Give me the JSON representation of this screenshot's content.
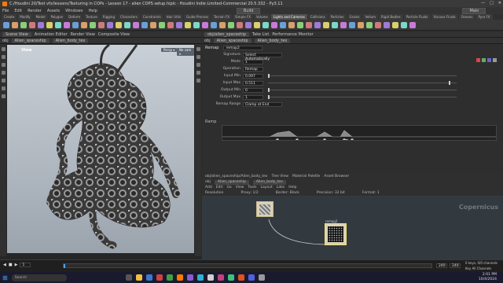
{
  "title": "C:/Houdini 20/Test vfx/lessons/Texturing in COPs - Lesson 17 - alien COPS setup.hiplc - Houdini Indie Limited-Commercial 20.5.332 - Py3.11",
  "window_controls": [
    "—",
    "□",
    "✕"
  ],
  "menu": [
    "File",
    "Edit",
    "Render",
    "Assets",
    "Windows",
    "Help"
  ],
  "build_label": "Build",
  "main_label": "Main",
  "shelf_tabs": [
    "Create",
    "Modify",
    "Model",
    "Polygon",
    "Deform",
    "Texture",
    "Rigging",
    "Characters",
    "Constraints",
    "Hair Utils",
    "Guide Process",
    "Terrain FX",
    "Simple FX",
    "Volume",
    "Lights and Cameras",
    "Collisions",
    "Particles",
    "Grains",
    "Vellum",
    "Rigid Bodies",
    "Particle Fluids",
    "Viscous Fluids",
    "Oceans",
    "Pyro FX"
  ],
  "shelf_active_index": 14,
  "left_panel": {
    "tabs": [
      "Scene View",
      "Animation Editor",
      "Render View",
      "Composite View",
      "Motion FX View",
      "Geometry Spreadsheet"
    ],
    "path": [
      "obj",
      "Alien_spaceship",
      "Alien_body_tex"
    ],
    "viewport_label": "View",
    "persp": "Persp ▾",
    "cam": "No cam ▾"
  },
  "right_panel": {
    "tabs": [
      "obj/alien_spaceship",
      "Take List",
      "Performance Monitor"
    ],
    "path": [
      "obj",
      "Alien_spaceship",
      "Alien_body_tex"
    ],
    "node_type": "Remap",
    "node_name": "remap2",
    "params": [
      {
        "label": "Signature",
        "value": "Select Automatically"
      },
      {
        "label": "Mode",
        "value": "1"
      },
      {
        "label": "Operation",
        "value": "Remap"
      },
      {
        "label": "Input Min",
        "value": "0.097"
      },
      {
        "label": "Input Max",
        "value": "0.511"
      },
      {
        "label": "Output Min",
        "value": "0"
      },
      {
        "label": "Output Max",
        "value": "1"
      },
      {
        "label": "Remap Range",
        "value": "Clamp at End"
      }
    ],
    "ramp_label": "Ramp",
    "network_tabs": [
      "obj/alien_spaceship/Alien_body_tex",
      "Tree View",
      "Material Palette",
      "Asset Browser"
    ],
    "network_path": [
      "obj",
      "Alien_spaceship",
      "Alien_body_tex"
    ],
    "network_menu": [
      "Add",
      "Edit",
      "Go",
      "View",
      "Tools",
      "Layout",
      "Labs",
      "Help"
    ],
    "net_info": [
      "Resolution",
      "Proxy: 1/2",
      "Border: Black",
      "Precision: 32 bit",
      "Format: 1"
    ],
    "network_type": "Copernicus",
    "node_label": "remap2"
  },
  "timeline": {
    "frame": "1",
    "start": "1",
    "end": "240",
    "end2": "240"
  },
  "status": {
    "keys": "0 keys, 0/0 channels",
    "auto": "Key All Channels",
    "mode": "Auto Update"
  },
  "taskbar": {
    "search": "Search",
    "time": "2:01 PM",
    "date": "10/4/2024",
    "lang": "ENG"
  }
}
